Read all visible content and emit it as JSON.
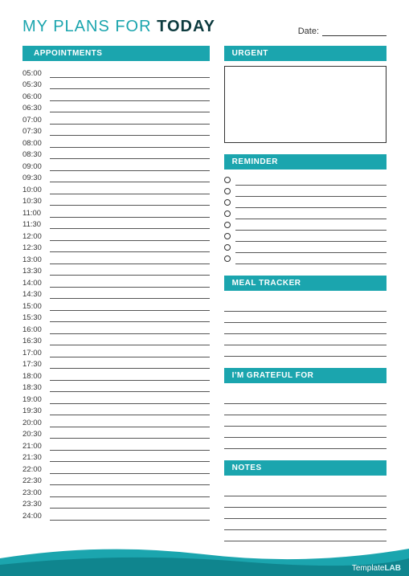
{
  "header": {
    "title_prefix": "MY PLANS FOR ",
    "title_bold": "TODAY",
    "date_label": "Date:"
  },
  "sections": {
    "appointments": "APPOINTMENTS",
    "urgent": "URGENT",
    "reminder": "REMINDER",
    "meal": "MEAL TRACKER",
    "grateful": "I'M GRATEFUL FOR",
    "notes": "NOTES"
  },
  "appointments": {
    "times": [
      "05:00",
      "05:30",
      "06:00",
      "06:30",
      "07:00",
      "07:30",
      "08:00",
      "08:30",
      "09:00",
      "09:30",
      "10:00",
      "10:30",
      "11:00",
      "11:30",
      "12:00",
      "12:30",
      "13:00",
      "13:30",
      "14:00",
      "14:30",
      "15:00",
      "15:30",
      "16:00",
      "16:30",
      "17:00",
      "17:30",
      "18:00",
      "18:30",
      "19:00",
      "19:30",
      "20:00",
      "20:30",
      "21:00",
      "21:30",
      "22:00",
      "22:30",
      "23:00",
      "23:30",
      "24:00"
    ]
  },
  "reminder": {
    "count": 8
  },
  "meal": {
    "lines": 5
  },
  "grateful": {
    "lines": 5
  },
  "notes": {
    "lines": 5
  },
  "footer": {
    "brand_prefix": "Template",
    "brand_accent": "LAB"
  }
}
